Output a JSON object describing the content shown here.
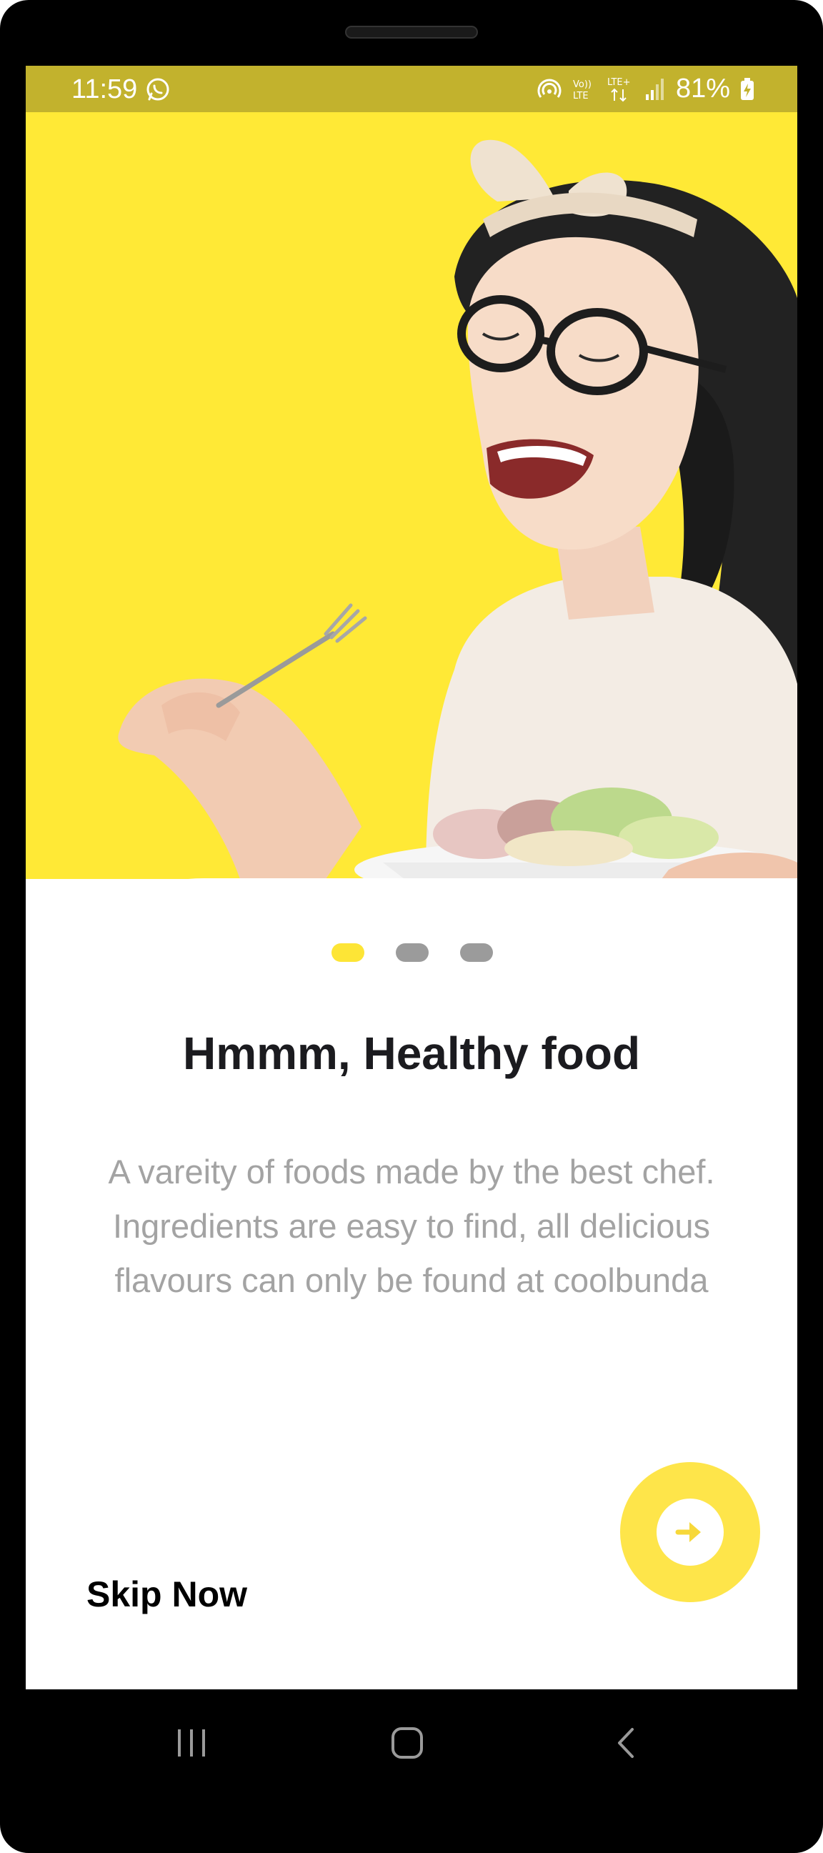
{
  "status_bar": {
    "time": "11:59",
    "battery": "81%",
    "network_labels": [
      "Vo)) LTE",
      "LTE+"
    ],
    "color": "#c2b22d"
  },
  "hero": {
    "background": "#ffe936"
  },
  "pager": {
    "active_index": 0,
    "count": 3,
    "active_color": "#fde536",
    "inactive_color": "#9b9b9b"
  },
  "content": {
    "title": "Hmmm, Healthy food",
    "description": "A vareity of foods made by the best chef. Ingredients are easy to find, all delicious flavours can only be found at coolbunda"
  },
  "actions": {
    "skip_label": "Skip Now",
    "next_icon": "arrow-right-icon",
    "accent": "#fee54a"
  },
  "navigation": {
    "icons": [
      "recent-apps-icon",
      "home-icon",
      "back-icon"
    ]
  }
}
